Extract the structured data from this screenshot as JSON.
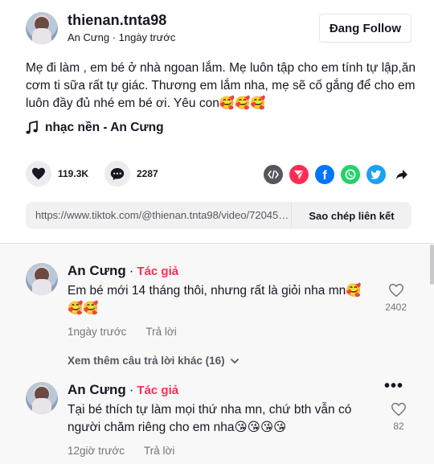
{
  "header": {
    "username": "thienan.tnta98",
    "nickname": "An Cưng",
    "separator": " · ",
    "posted": "1ngày trước",
    "follow_label": "Đang Follow"
  },
  "caption": "Mẹ đi làm , em bé ở nhà ngoan lắm. Mẹ luôn tập cho em tính tự lập,ăn cơm ti sữa rất tự giác. Thương em lắm nha, mẹ sẽ cố gắng để cho em luôn đầy đủ nhé em bé ơi. Yêu con🥰🥰🥰",
  "music": {
    "icon": "music-note-icon",
    "label": "nhạc nền - An Cưng"
  },
  "actions": {
    "likes": "119.3K",
    "comments": "2287",
    "share_icons": [
      "embed-icon",
      "send-to-friends-icon",
      "facebook-icon",
      "whatsapp-icon",
      "twitter-icon",
      "share-arrow-icon"
    ]
  },
  "link": {
    "url": "https://www.tiktok.com/@thienan.tnta98/video/7204567890123456789",
    "copy_label": "Sao chép liên kết"
  },
  "comments": [
    {
      "author": "An Cưng",
      "dot": "·",
      "badge": "Tác giả",
      "text": "Em bé mới 14 tháng thôi, nhưng rất là giỏi nha mn🥰🥰🥰",
      "time": "1ngày trước",
      "reply": "Trả lời",
      "likes": "2402"
    },
    {
      "author": "An Cưng",
      "dot": "·",
      "badge": "Tác giả",
      "text": "Tại bé thích tự làm mọi thứ nha mn, chứ bth vẫn có người chăm riêng cho em nha😘😘😘😘",
      "time": "12giờ trước",
      "reply": "Trả lời",
      "likes": "82"
    }
  ],
  "view_more": "Xem thêm câu trả lời khác (16)",
  "colors": {
    "accent": "#fe2c55",
    "facebook": "#0075fa",
    "whatsapp": "#25d366",
    "twitter": "#1da1f2",
    "muted": "#73747b"
  }
}
